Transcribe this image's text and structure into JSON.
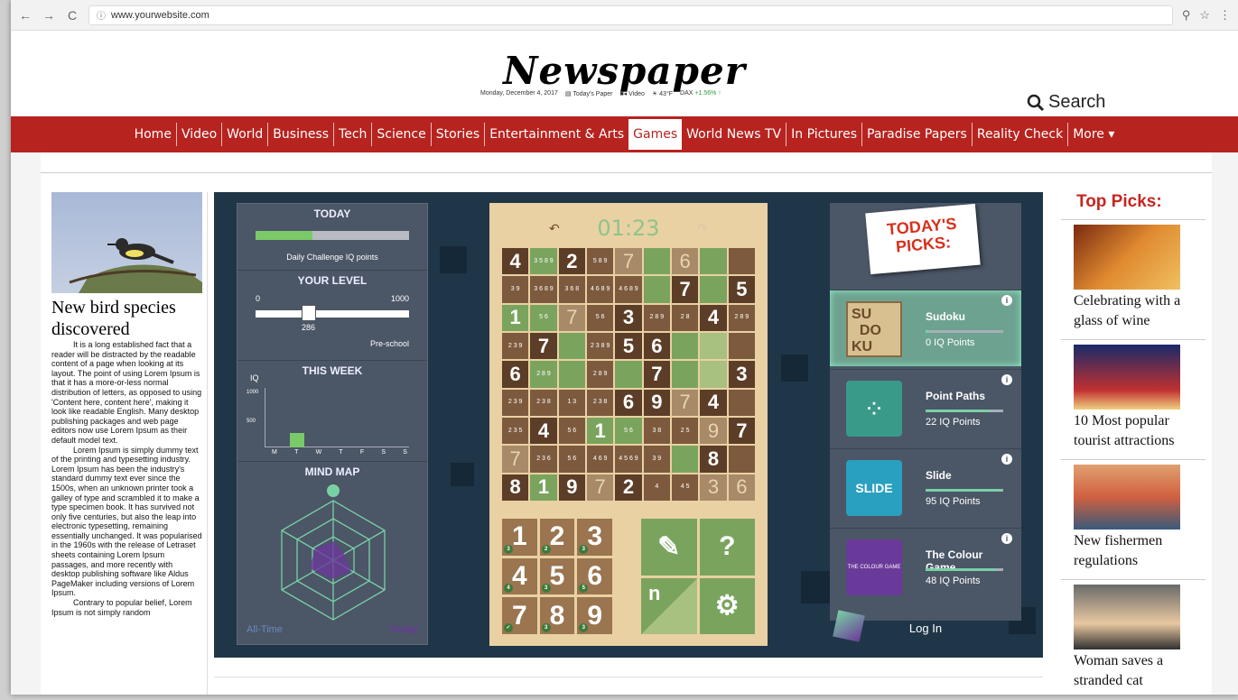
{
  "browser": {
    "url": "www.yourwebsite.com",
    "back_icon": "arrow-left-icon",
    "forward_icon": "arrow-right-icon",
    "reload_icon": "reload-icon"
  },
  "header": {
    "logo": "Newspaper",
    "date": "Monday, December 4, 2017",
    "todays_paper": "Today's Paper",
    "video": "Video",
    "weather": "43°F",
    "dax_label": "DAX",
    "dax_value": "+1.56% ↑",
    "search_label": "Search"
  },
  "nav": {
    "items": [
      "Home",
      "Video",
      "World",
      "Business",
      "Tech",
      "Science",
      "Stories",
      "Entertainment & Arts",
      "Games",
      "World News TV",
      "In Pictures",
      "Paradise Papers",
      "Reality Check",
      "More ▾"
    ],
    "active": "Games"
  },
  "article": {
    "title": "New bird species discovered",
    "body": "It is a long established fact that a reader will be distracted by the readable content of a page when looking at its layout. The point of using Lorem Ipsum is that it has a more-or-less normal distribution of letters, as opposed to using 'Content here, content here', making it look like readable English. Many desktop publishing packages and web page editors now use Lorem Ipsum as their default model text.",
    "body2": "Lorem Ipsum is simply dummy text of the printing and typesetting industry. Lorem Ipsum has been the industry's standard dummy text ever since the 1500s, when an unknown printer took a galley of type and scrambled it to make a type specimen book. It has survived not only five centuries, but also the leap into electronic typesetting, remaining essentially unchanged. It was popularised in the 1960s with the release of Letraset sheets containing Lorem Ipsum passages, and more recently with desktop publishing software like Aldus PageMaker including versions of Lorem Ipsum.",
    "body3": "Contrary to popular belief, Lorem Ipsum is not simply random"
  },
  "game": {
    "today_title": "TODAY",
    "daily_label": "Daily Challenge IQ points",
    "daily_progress": 0.37,
    "level_title": "YOUR LEVEL",
    "level_min": "0",
    "level_max": "1000",
    "level_value": "286",
    "level_name": "Pre-school",
    "week_title": "THIS WEEK",
    "week_axis": "IQ",
    "week_tick_1000": "1000",
    "week_tick_500": "500",
    "week_days": [
      "M",
      "T",
      "W",
      "T",
      "F",
      "S",
      "S"
    ],
    "mindmap_title": "MIND MAP",
    "all_time": "All-Time",
    "today_label": "Today",
    "timer": "01:23",
    "numpad": [
      "1",
      "2",
      "3",
      "4",
      "5",
      "6",
      "7",
      "8",
      "9"
    ],
    "numpad_badges": [
      "3",
      "2",
      "3",
      "4",
      "3",
      "5",
      "✓",
      "3",
      "3"
    ],
    "tools": [
      "pencil-icon",
      "question-icon",
      "notes-icon",
      "settings-icon"
    ],
    "tool_question": "?",
    "tool_notes": "n",
    "picks_title": "TODAY'S PICKS:",
    "picks": [
      {
        "name": "Sudoku",
        "points": "0 IQ Points",
        "progress": 0.05
      },
      {
        "name": "Point Paths",
        "points": "22 IQ Points",
        "progress": 0.82
      },
      {
        "name": "Slide",
        "points": "95 IQ Points",
        "progress": 0.98
      },
      {
        "name": "The Colour Game",
        "points": "48 IQ Points",
        "progress": 0.9
      }
    ],
    "sudoku_thumb": [
      "SU",
      "DO",
      "KU"
    ],
    "slide_thumb": "SLIDE",
    "colour_thumb": "THE COLOUR GAME",
    "login": "Log In"
  },
  "sidebar": {
    "title": "Top Picks:",
    "stories": [
      "Celebrating with a glass of wine",
      "10 Most popular tourist attractions",
      "New fishermen regulations",
      "Woman saves a stranded cat"
    ]
  },
  "colors": {
    "brand_red": "#b7231f",
    "game_bg": "#1f3648",
    "accent_green": "#7aa45e"
  }
}
